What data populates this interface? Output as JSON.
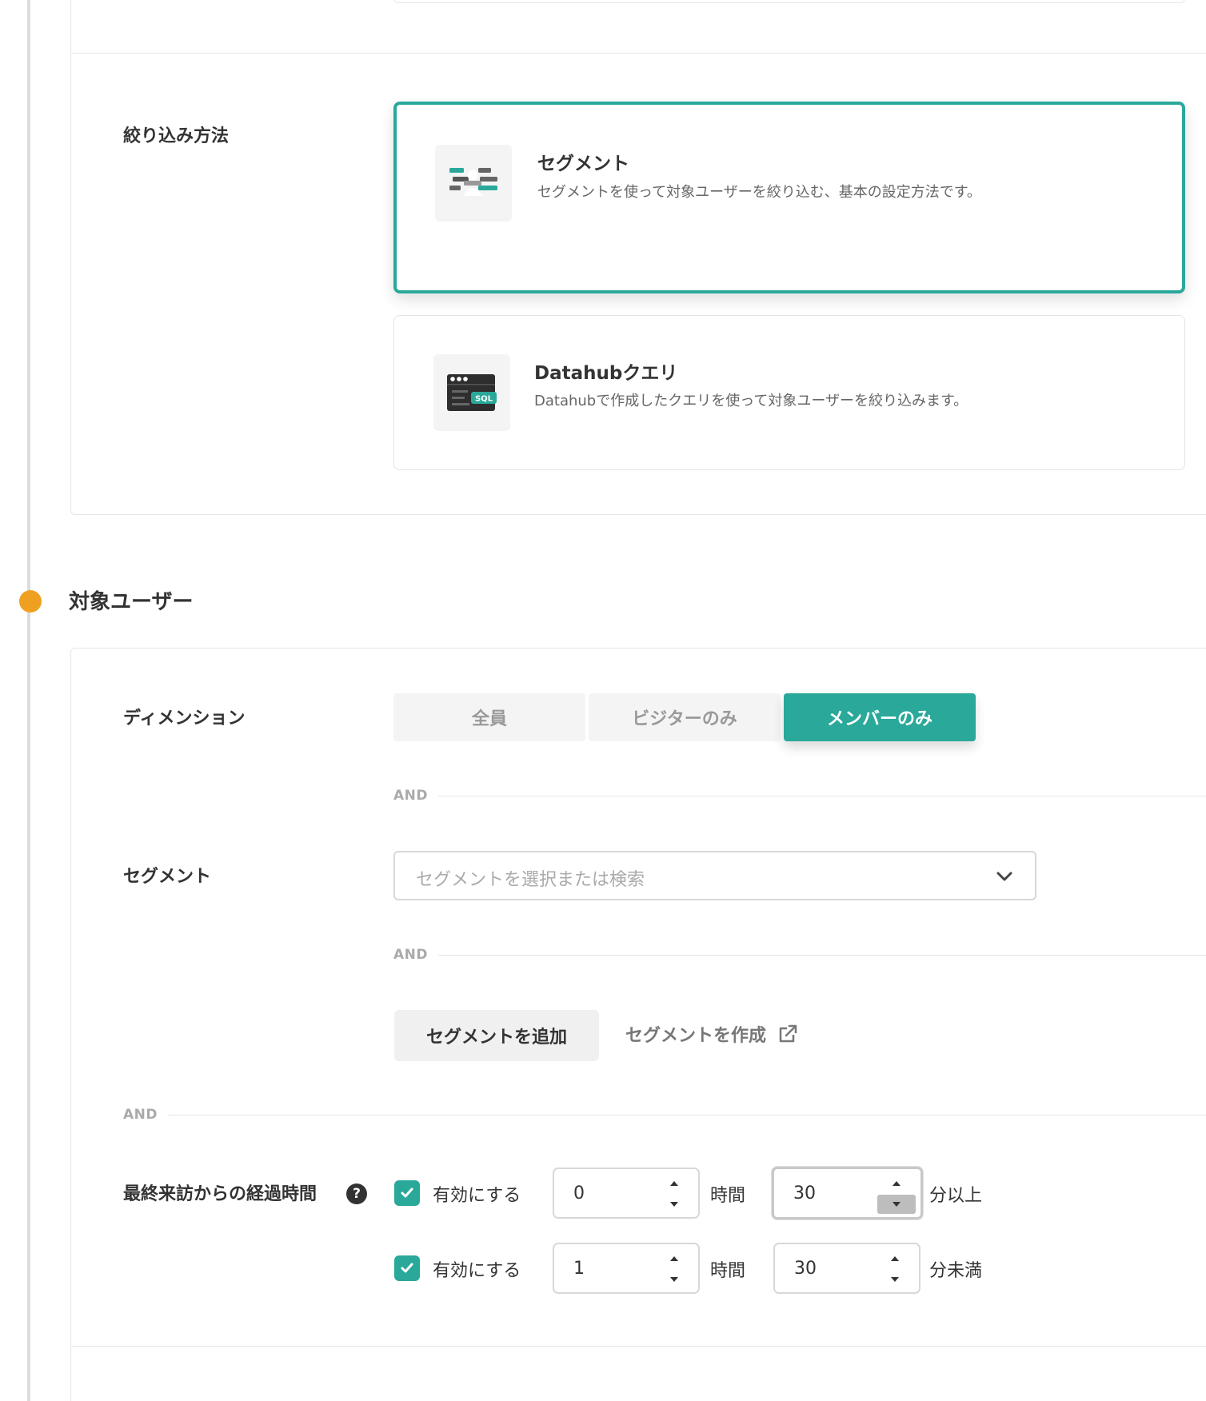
{
  "filter_method": {
    "label": "絞り込み方法",
    "options": [
      {
        "title": "セグメント",
        "description": "セグメントを使って対象ユーザーを絞り込む、基本の設定方法です。",
        "icon": "segment-icon",
        "selected": true
      },
      {
        "title": "Datahubクエリ",
        "description": "Datahubで作成したクエリを使って対象ユーザーを絞り込みます。",
        "icon": "sql-icon",
        "icon_badge": "SQL",
        "selected": false
      }
    ]
  },
  "target_users": {
    "title": "対象ユーザー",
    "dimension": {
      "label": "ディメンション",
      "options": [
        "全員",
        "ビジターのみ",
        "メンバーのみ"
      ],
      "selected": "メンバーのみ"
    },
    "and_label": "AND",
    "segment": {
      "label": "セグメント",
      "placeholder": "セグメントを選択または検索",
      "add_button": "セグメントを追加",
      "create_link": "セグメントを作成"
    },
    "elapsed": {
      "label": "最終来訪からの経過時間",
      "help_icon": "question-circle-icon",
      "rows": [
        {
          "enabled": true,
          "enable_label": "有効にする",
          "hours": "0",
          "hours_unit": "時間",
          "minutes": "30",
          "minutes_unit": "分以上"
        },
        {
          "enabled": true,
          "enable_label": "有効にする",
          "hours": "1",
          "hours_unit": "時間",
          "minutes": "30",
          "minutes_unit": "分未満"
        }
      ]
    }
  },
  "colors": {
    "accent": "#2aa89a",
    "timeline_dot": "#f0a020",
    "border": "#e6e6e6"
  }
}
